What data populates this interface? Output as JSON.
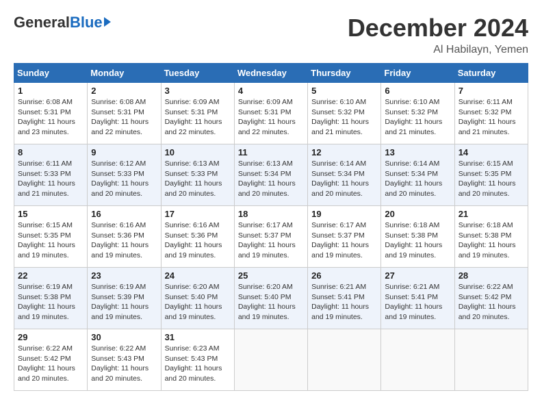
{
  "header": {
    "logo_general": "General",
    "logo_blue": "Blue",
    "month_title": "December 2024",
    "location": "Al Habilayn, Yemen"
  },
  "days_of_week": [
    "Sunday",
    "Monday",
    "Tuesday",
    "Wednesday",
    "Thursday",
    "Friday",
    "Saturday"
  ],
  "weeks": [
    [
      {
        "day": 1,
        "info": "Sunrise: 6:08 AM\nSunset: 5:31 PM\nDaylight: 11 hours\nand 23 minutes."
      },
      {
        "day": 2,
        "info": "Sunrise: 6:08 AM\nSunset: 5:31 PM\nDaylight: 11 hours\nand 22 minutes."
      },
      {
        "day": 3,
        "info": "Sunrise: 6:09 AM\nSunset: 5:31 PM\nDaylight: 11 hours\nand 22 minutes."
      },
      {
        "day": 4,
        "info": "Sunrise: 6:09 AM\nSunset: 5:31 PM\nDaylight: 11 hours\nand 22 minutes."
      },
      {
        "day": 5,
        "info": "Sunrise: 6:10 AM\nSunset: 5:32 PM\nDaylight: 11 hours\nand 21 minutes."
      },
      {
        "day": 6,
        "info": "Sunrise: 6:10 AM\nSunset: 5:32 PM\nDaylight: 11 hours\nand 21 minutes."
      },
      {
        "day": 7,
        "info": "Sunrise: 6:11 AM\nSunset: 5:32 PM\nDaylight: 11 hours\nand 21 minutes."
      }
    ],
    [
      {
        "day": 8,
        "info": "Sunrise: 6:11 AM\nSunset: 5:33 PM\nDaylight: 11 hours\nand 21 minutes."
      },
      {
        "day": 9,
        "info": "Sunrise: 6:12 AM\nSunset: 5:33 PM\nDaylight: 11 hours\nand 20 minutes."
      },
      {
        "day": 10,
        "info": "Sunrise: 6:13 AM\nSunset: 5:33 PM\nDaylight: 11 hours\nand 20 minutes."
      },
      {
        "day": 11,
        "info": "Sunrise: 6:13 AM\nSunset: 5:34 PM\nDaylight: 11 hours\nand 20 minutes."
      },
      {
        "day": 12,
        "info": "Sunrise: 6:14 AM\nSunset: 5:34 PM\nDaylight: 11 hours\nand 20 minutes."
      },
      {
        "day": 13,
        "info": "Sunrise: 6:14 AM\nSunset: 5:34 PM\nDaylight: 11 hours\nand 20 minutes."
      },
      {
        "day": 14,
        "info": "Sunrise: 6:15 AM\nSunset: 5:35 PM\nDaylight: 11 hours\nand 20 minutes."
      }
    ],
    [
      {
        "day": 15,
        "info": "Sunrise: 6:15 AM\nSunset: 5:35 PM\nDaylight: 11 hours\nand 19 minutes."
      },
      {
        "day": 16,
        "info": "Sunrise: 6:16 AM\nSunset: 5:36 PM\nDaylight: 11 hours\nand 19 minutes."
      },
      {
        "day": 17,
        "info": "Sunrise: 6:16 AM\nSunset: 5:36 PM\nDaylight: 11 hours\nand 19 minutes."
      },
      {
        "day": 18,
        "info": "Sunrise: 6:17 AM\nSunset: 5:37 PM\nDaylight: 11 hours\nand 19 minutes."
      },
      {
        "day": 19,
        "info": "Sunrise: 6:17 AM\nSunset: 5:37 PM\nDaylight: 11 hours\nand 19 minutes."
      },
      {
        "day": 20,
        "info": "Sunrise: 6:18 AM\nSunset: 5:38 PM\nDaylight: 11 hours\nand 19 minutes."
      },
      {
        "day": 21,
        "info": "Sunrise: 6:18 AM\nSunset: 5:38 PM\nDaylight: 11 hours\nand 19 minutes."
      }
    ],
    [
      {
        "day": 22,
        "info": "Sunrise: 6:19 AM\nSunset: 5:38 PM\nDaylight: 11 hours\nand 19 minutes."
      },
      {
        "day": 23,
        "info": "Sunrise: 6:19 AM\nSunset: 5:39 PM\nDaylight: 11 hours\nand 19 minutes."
      },
      {
        "day": 24,
        "info": "Sunrise: 6:20 AM\nSunset: 5:40 PM\nDaylight: 11 hours\nand 19 minutes."
      },
      {
        "day": 25,
        "info": "Sunrise: 6:20 AM\nSunset: 5:40 PM\nDaylight: 11 hours\nand 19 minutes."
      },
      {
        "day": 26,
        "info": "Sunrise: 6:21 AM\nSunset: 5:41 PM\nDaylight: 11 hours\nand 19 minutes."
      },
      {
        "day": 27,
        "info": "Sunrise: 6:21 AM\nSunset: 5:41 PM\nDaylight: 11 hours\nand 19 minutes."
      },
      {
        "day": 28,
        "info": "Sunrise: 6:22 AM\nSunset: 5:42 PM\nDaylight: 11 hours\nand 20 minutes."
      }
    ],
    [
      {
        "day": 29,
        "info": "Sunrise: 6:22 AM\nSunset: 5:42 PM\nDaylight: 11 hours\nand 20 minutes."
      },
      {
        "day": 30,
        "info": "Sunrise: 6:22 AM\nSunset: 5:43 PM\nDaylight: 11 hours\nand 20 minutes."
      },
      {
        "day": 31,
        "info": "Sunrise: 6:23 AM\nSunset: 5:43 PM\nDaylight: 11 hours\nand 20 minutes."
      },
      null,
      null,
      null,
      null
    ]
  ]
}
